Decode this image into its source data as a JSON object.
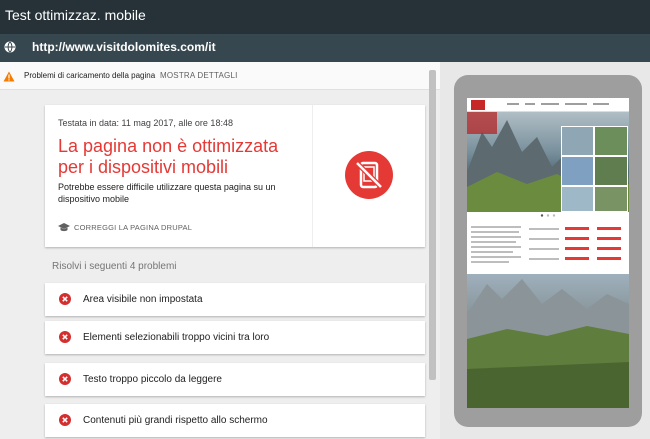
{
  "window": {
    "title": "Test ottimizzaz. mobile"
  },
  "address": {
    "url": "http://www.visitdolomites.com/it"
  },
  "warning": {
    "text": "Problemi di caricamento della pagina",
    "link": "MOSTRA DETTAGLI"
  },
  "result": {
    "date": "Testata in data: 11 mag 2017, alle ore 18:48",
    "headline": "La pagina non è ottimizzata per i dispositivi mobili",
    "description": "Potrebbe essere difficile utilizzare questa pagina su un dispositivo mobile",
    "fix_link": "CORREGGI LA PAGINA DRUPAL",
    "status_color": "#e53935"
  },
  "problems": {
    "heading": "Risolvi i seguenti 4 problemi",
    "items": [
      {
        "label": "Area visibile non impostata"
      },
      {
        "label": "Elementi selezionabili troppo vicini tra loro"
      },
      {
        "label": "Testo troppo piccolo da leggere"
      },
      {
        "label": "Contenuti più grandi rispetto allo schermo"
      }
    ]
  },
  "icons": {
    "globe": "globe-icon",
    "warning": "warning-icon",
    "not_mobile": "phone-not-mobile-friendly-icon",
    "fix": "graduation-cap-icon",
    "error": "error-x-icon"
  }
}
